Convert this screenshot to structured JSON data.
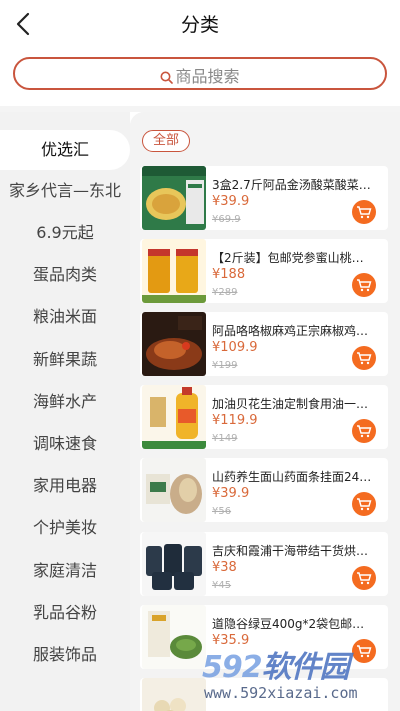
{
  "header": {
    "title": "分类"
  },
  "search": {
    "placeholder": "商品搜索"
  },
  "sidebar": {
    "items": [
      {
        "label": "优选汇",
        "active": true
      },
      {
        "label": "家乡代言—东北",
        "active": false
      },
      {
        "label": "6.9元起",
        "active": false
      },
      {
        "label": "蛋品肉类",
        "active": false
      },
      {
        "label": "粮油米面",
        "active": false
      },
      {
        "label": "新鲜果蔬",
        "active": false
      },
      {
        "label": "海鲜水产",
        "active": false
      },
      {
        "label": "调味速食",
        "active": false
      },
      {
        "label": "家用电器",
        "active": false
      },
      {
        "label": "个护美妆",
        "active": false
      },
      {
        "label": "家庭清洁",
        "active": false
      },
      {
        "label": "乳品谷粉",
        "active": false
      },
      {
        "label": "服装饰品",
        "active": false
      }
    ]
  },
  "filter": {
    "all_label": "全部"
  },
  "products": [
    {
      "name": "3盒2.7斤阿品金汤酸菜酸菜鱼调料",
      "price": "¥39.9",
      "original_price": "¥69.9",
      "thumb_icon": "fish-soup-package-image"
    },
    {
      "name": "【2斤装】包邮党参蜜山桃花蜂蜜",
      "price": "¥188",
      "original_price": "¥289",
      "thumb_icon": "honey-jar-image"
    },
    {
      "name": "阿品咯咯椒麻鸡正宗麻椒鸡凉拌菜",
      "price": "¥109.9",
      "original_price": "¥199",
      "thumb_icon": "spicy-chicken-image"
    },
    {
      "name": "加油贝花生油定制食用油一级压榨",
      "price": "¥119.9",
      "original_price": "¥149",
      "thumb_icon": "peanut-oil-bottle-image"
    },
    {
      "name": "山药养生面山药面条挂面240g",
      "price": "¥39.9",
      "original_price": "¥56",
      "thumb_icon": "noodle-package-image"
    },
    {
      "name": "吉庆和霞浦干海带结干货烘干海带",
      "price": "¥38",
      "original_price": "¥45",
      "thumb_icon": "kelp-bags-image"
    },
    {
      "name": "道隐谷绿豆400g*2袋包邮纯正绿豆",
      "price": "¥35.9",
      "original_price": "",
      "thumb_icon": "mung-bean-image"
    }
  ],
  "colors": {
    "accent": "#c9553d",
    "price": "#d9693a",
    "cart": "#f46b20"
  },
  "watermark": {
    "brand_num": "592",
    "brand_text": "软件园",
    "url": "www.592xiazai.com"
  }
}
